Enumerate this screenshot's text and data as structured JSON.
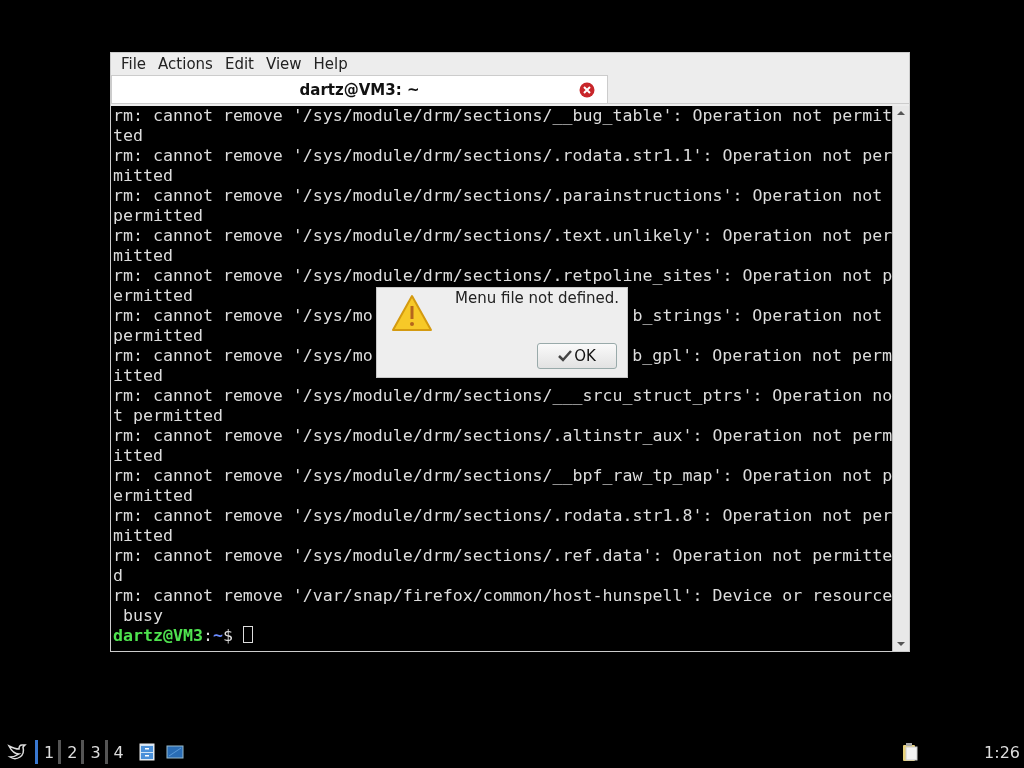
{
  "window": {
    "menu": [
      "File",
      "Actions",
      "Edit",
      "View",
      "Help"
    ],
    "tabs": [
      {
        "title": "dartz@VM3: ~",
        "selected": true
      }
    ],
    "terminal": {
      "lines": [
        {
          "text": "rm: cannot remove '/sys/module/drm/sections/__bug_table': Operation not permit"
        },
        {
          "text": "ted"
        },
        {
          "text": "rm: cannot remove '/sys/module/drm/sections/.rodata.str1.1': Operation not per"
        },
        {
          "text": "mitted"
        },
        {
          "text": "rm: cannot remove '/sys/module/drm/sections/.parainstructions': Operation not"
        },
        {
          "text": "permitted"
        },
        {
          "text": "rm: cannot remove '/sys/module/drm/sections/.text.unlikely': Operation not per"
        },
        {
          "text": "mitted"
        },
        {
          "text": "rm: cannot remove '/sys/module/drm/sections/.retpoline_sites': Operation not p"
        },
        {
          "text": "ermitted"
        },
        {
          "left": "rm: cannot remove '/sys/mo",
          "right": "b_strings': Operation not"
        },
        {
          "text": "permitted"
        },
        {
          "left": "rm: cannot remove '/sys/mo",
          "right": "b_gpl': Operation not perm"
        },
        {
          "text": "itted"
        },
        {
          "text": "rm: cannot remove '/sys/module/drm/sections/___srcu_struct_ptrs': Operation no"
        },
        {
          "text": "t permitted"
        },
        {
          "text": "rm: cannot remove '/sys/module/drm/sections/.altinstr_aux': Operation not perm"
        },
        {
          "text": "itted"
        },
        {
          "text": "rm: cannot remove '/sys/module/drm/sections/__bpf_raw_tp_map': Operation not p"
        },
        {
          "text": "ermitted"
        },
        {
          "text": "rm: cannot remove '/sys/module/drm/sections/.rodata.str1.8': Operation not per"
        },
        {
          "text": "mitted"
        },
        {
          "text": "rm: cannot remove '/sys/module/drm/sections/.ref.data': Operation not permitte"
        },
        {
          "text": "d"
        },
        {
          "text": "rm: cannot remove '/var/snap/firefox/common/host-hunspell': Device or resource"
        },
        {
          "text": " busy"
        }
      ],
      "prompt": {
        "user_host": "dartz@VM3",
        "separator": ":",
        "path": "~",
        "symbol": "$"
      }
    }
  },
  "dialog": {
    "message": "Menu file not defined.",
    "button": "OK"
  },
  "taskbar": {
    "desktops": [
      {
        "label": "1",
        "selected": true
      },
      {
        "label": "2",
        "selected": false
      },
      {
        "label": "3",
        "selected": false
      },
      {
        "label": "4",
        "selected": false
      }
    ],
    "clock": "1:26"
  }
}
